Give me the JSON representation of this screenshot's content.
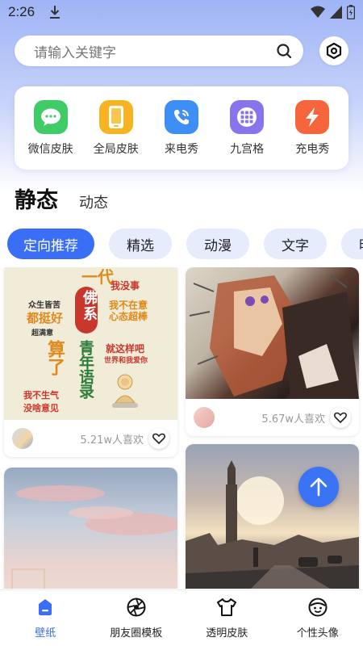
{
  "status_bar": {
    "time": "2:26"
  },
  "search": {
    "placeholder": "请输入关键字"
  },
  "shortcuts": [
    {
      "label": "微信皮肤",
      "color": "#3fcc67",
      "icon": "wechat-icon"
    },
    {
      "label": "全局皮肤",
      "color": "#f7b320",
      "icon": "phone-skin-icon"
    },
    {
      "label": "来电秀",
      "color": "#3d8ef5",
      "icon": "phone-call-icon"
    },
    {
      "label": "九宫格",
      "color": "#8a74ee",
      "icon": "grid-icon"
    },
    {
      "label": "充电秀",
      "color": "#f7653c",
      "icon": "lightning-icon"
    }
  ],
  "mode_tabs": {
    "active": "静态",
    "inactive": "动态"
  },
  "categories": [
    "定向推荐",
    "精选",
    "动漫",
    "文字",
    "明"
  ],
  "cards": [
    {
      "likes": "5.21w人喜欢",
      "poster": {
        "top": "佛系",
        "col_left": [
          "众生皆苦",
          "都挺好",
          "超满意"
        ],
        "col_center_top": "一代",
        "col_right": [
          "我没事",
          "我不在意",
          "心态超棒"
        ],
        "big_left": "算了",
        "big_mid": "青年语录",
        "side_right": [
          "就这样吧",
          "世界和我爱你"
        ],
        "bottom": [
          "我不生气",
          "没啥意见"
        ]
      }
    },
    {
      "likes": "5.67w人喜欢"
    }
  ],
  "bottom_nav": [
    {
      "label": "壁纸",
      "icon": "wallpaper-icon",
      "active": true
    },
    {
      "label": "朋友圈模板",
      "icon": "aperture-icon",
      "active": false
    },
    {
      "label": "透明皮肤",
      "icon": "tshirt-icon",
      "active": false
    },
    {
      "label": "个性头像",
      "icon": "face-icon",
      "active": false
    }
  ],
  "colors": {
    "accent": "#3a6ef6",
    "chip_bg": "#e6ecfb"
  }
}
